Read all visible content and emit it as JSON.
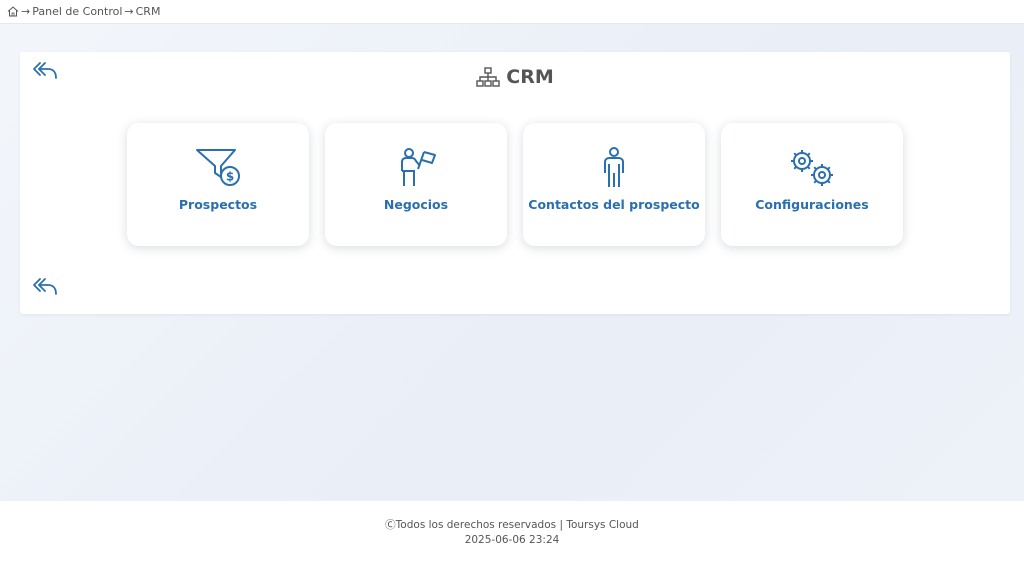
{
  "breadcrumb": {
    "home_icon": "home-icon",
    "separator": "→",
    "items": [
      "Panel de Control",
      "CRM"
    ]
  },
  "header": {
    "title": "CRM",
    "title_icon": "org-chart-icon"
  },
  "cards": [
    {
      "label": "Prospectos",
      "icon": "funnel-dollar-icon"
    },
    {
      "label": "Negocios",
      "icon": "person-flag-icon"
    },
    {
      "label": "Contactos del prospecto",
      "icon": "person-icon"
    },
    {
      "label": "Configuraciones",
      "icon": "gears-icon"
    }
  ],
  "footer": {
    "copyright": "ⒸTodos los derechos reservados | Toursys Cloud",
    "timestamp": "2025-06-06 23:24"
  },
  "colors": {
    "accent": "#2a6fb0",
    "text": "#555555"
  }
}
